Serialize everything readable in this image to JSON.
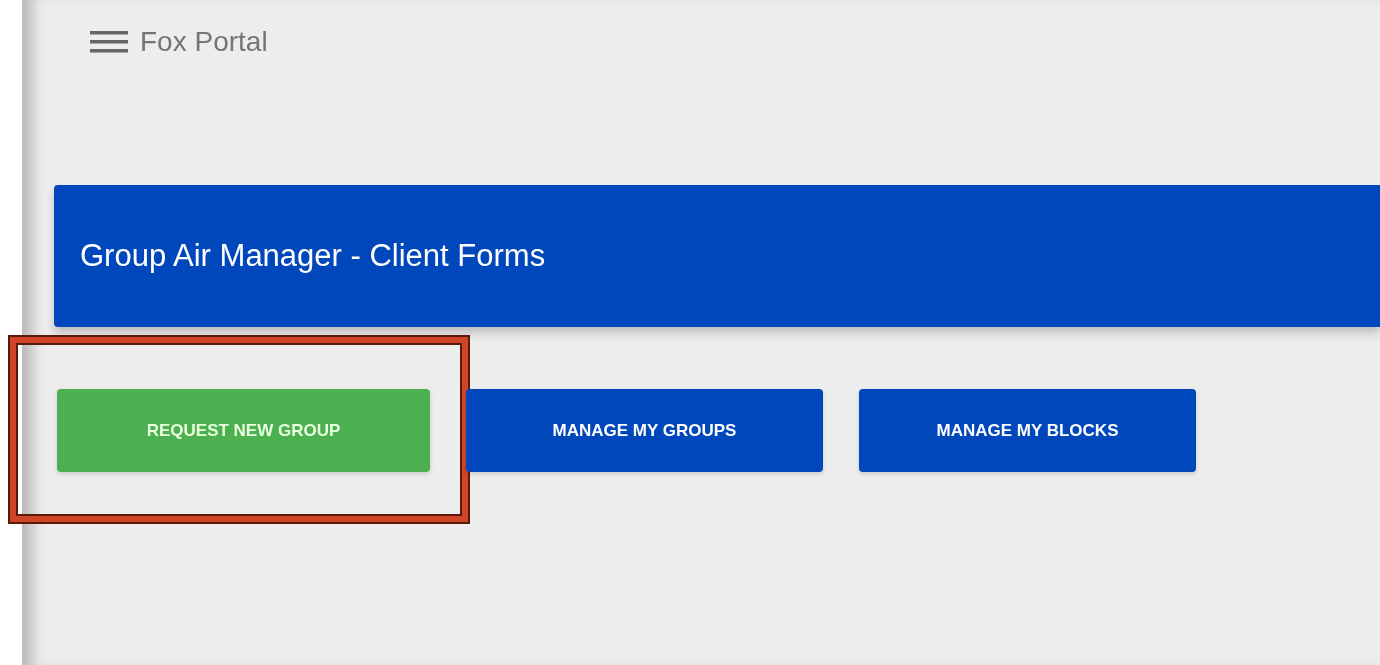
{
  "app_bar": {
    "title": "Fox Portal"
  },
  "banner": {
    "title": "Group Air Manager - Client Forms"
  },
  "buttons": [
    {
      "label": "REQUEST NEW GROUP",
      "color": "#4caf50",
      "highlighted": true
    },
    {
      "label": "MANAGE MY GROUPS",
      "color": "#0047bb",
      "highlighted": false
    },
    {
      "label": "MANAGE MY BLOCKS",
      "color": "#0047bb",
      "highlighted": false
    }
  ]
}
